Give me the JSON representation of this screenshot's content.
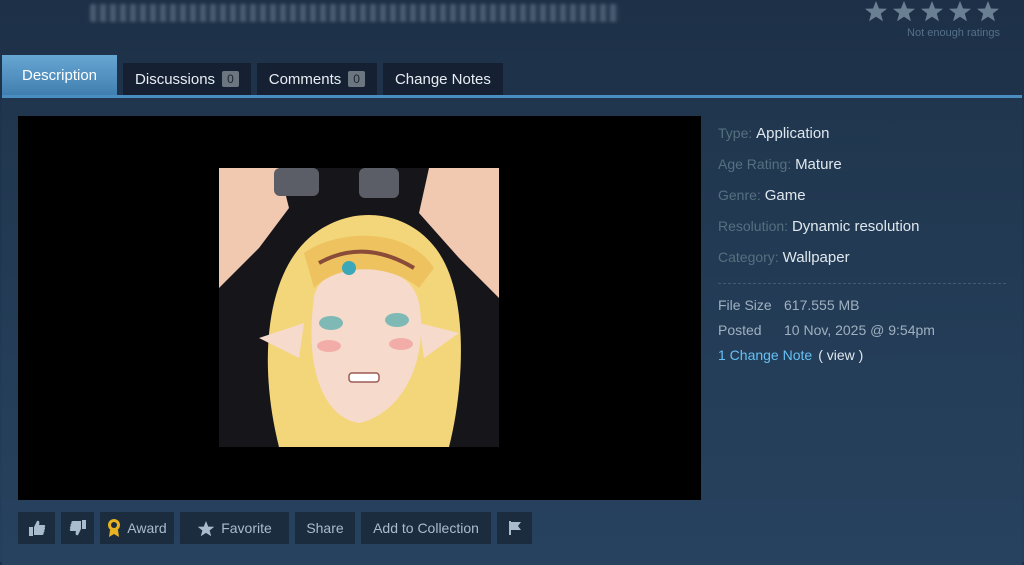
{
  "header": {
    "ratings_note": "Not enough ratings",
    "star_count": 5
  },
  "tabs": [
    {
      "label": "Description"
    },
    {
      "label": "Discussions",
      "count": "0"
    },
    {
      "label": "Comments",
      "count": "0"
    },
    {
      "label": "Change Notes"
    }
  ],
  "details": {
    "type_label": "Type:",
    "type_value": "Application",
    "age_label": "Age Rating:",
    "age_value": "Mature",
    "genre_label": "Genre:",
    "genre_value": "Game",
    "resolution_label": "Resolution:",
    "resolution_value": "Dynamic resolution",
    "category_label": "Category:",
    "category_value": "Wallpaper"
  },
  "meta": {
    "size_label": "File Size",
    "size_value": "617.555 MB",
    "posted_label": "Posted",
    "posted_value": "10 Nov, 2025 @ 9:54pm",
    "changenote_link": "1 Change Note",
    "view_link": "( view )"
  },
  "actions": {
    "award": "Award",
    "favorite": "Favorite",
    "share": "Share",
    "collection": "Add to Collection"
  },
  "icons": [
    "star-icon",
    "thumbs-up-icon",
    "thumbs-down-icon",
    "award-icon",
    "favorite-star-icon",
    "flag-icon"
  ],
  "colors": {
    "accent": "#66c0f4",
    "tab_active": "#4f92c4",
    "background": "#1f3650"
  }
}
